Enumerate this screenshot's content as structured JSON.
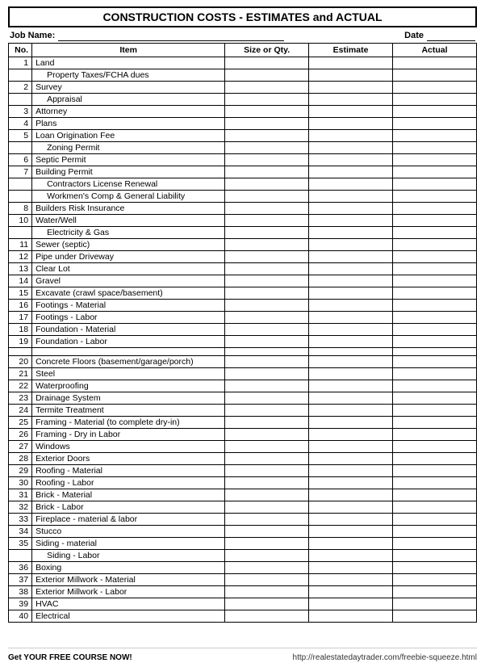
{
  "header": {
    "title": "CONSTRUCTION COSTS - ESTIMATES and ACTUAL",
    "job_name_label": "Job Name:",
    "date_label": "Date"
  },
  "columns": {
    "no": "No.",
    "item": "Item",
    "size_qty": "Size or Qty.",
    "estimate": "Estimate",
    "actual": "Actual"
  },
  "rows": [
    {
      "no": "1",
      "item": "Land",
      "indent": false
    },
    {
      "no": "",
      "item": "Property Taxes/FCHA dues",
      "indent": true
    },
    {
      "no": "2",
      "item": "Survey",
      "indent": false
    },
    {
      "no": "",
      "item": "Appraisal",
      "indent": true
    },
    {
      "no": "3",
      "item": "Attorney",
      "indent": false
    },
    {
      "no": "4",
      "item": "Plans",
      "indent": false
    },
    {
      "no": "5",
      "item": "Loan Origination Fee",
      "indent": false
    },
    {
      "no": "",
      "item": "Zoning Permit",
      "indent": true
    },
    {
      "no": "6",
      "item": "Septic Permit",
      "indent": false
    },
    {
      "no": "7",
      "item": "Building Permit",
      "indent": false
    },
    {
      "no": "",
      "item": "Contractors License Renewal",
      "indent": true
    },
    {
      "no": "",
      "item": "Workmen's Comp & General Liability",
      "indent": true
    },
    {
      "no": "8",
      "item": "Builders Risk Insurance",
      "indent": false
    },
    {
      "no": "10",
      "item": "Water/Well",
      "indent": false
    },
    {
      "no": "",
      "item": "Electricity & Gas",
      "indent": true
    },
    {
      "no": "11",
      "item": "Sewer (septic)",
      "indent": false
    },
    {
      "no": "12",
      "item": "Pipe under Driveway",
      "indent": false
    },
    {
      "no": "13",
      "item": "Clear Lot",
      "indent": false
    },
    {
      "no": "14",
      "item": "Gravel",
      "indent": false
    },
    {
      "no": "15",
      "item": "Excavate (crawl space/basement)",
      "indent": false
    },
    {
      "no": "16",
      "item": "Footings - Material",
      "indent": false
    },
    {
      "no": "17",
      "item": "Footings - Labor",
      "indent": false
    },
    {
      "no": "18",
      "item": "Foundation - Material",
      "indent": false
    },
    {
      "no": "19",
      "item": "Foundation - Labor",
      "indent": false
    },
    {
      "no": "",
      "item": "",
      "indent": false,
      "empty": true
    },
    {
      "no": "20",
      "item": "Concrete Floors (basement/garage/porch)",
      "indent": false
    },
    {
      "no": "21",
      "item": "Steel",
      "indent": false
    },
    {
      "no": "22",
      "item": "Waterproofing",
      "indent": false
    },
    {
      "no": "23",
      "item": "Drainage System",
      "indent": false
    },
    {
      "no": "24",
      "item": "Termite Treatment",
      "indent": false
    },
    {
      "no": "25",
      "item": "Framing - Material (to complete dry-in)",
      "indent": false
    },
    {
      "no": "26",
      "item": "Framing - Dry in Labor",
      "indent": false
    },
    {
      "no": "27",
      "item": "Windows",
      "indent": false
    },
    {
      "no": "28",
      "item": "Exterior Doors",
      "indent": false
    },
    {
      "no": "29",
      "item": "Roofing - Material",
      "indent": false
    },
    {
      "no": "30",
      "item": "Roofing - Labor",
      "indent": false
    },
    {
      "no": "31",
      "item": "Brick - Material",
      "indent": false
    },
    {
      "no": "32",
      "item": "Brick - Labor",
      "indent": false
    },
    {
      "no": "33",
      "item": "Fireplace - material & labor",
      "indent": false
    },
    {
      "no": "34",
      "item": "Stucco",
      "indent": false
    },
    {
      "no": "35",
      "item": "Siding - material",
      "indent": false
    },
    {
      "no": "",
      "item": "Siding - Labor",
      "indent": true
    },
    {
      "no": "36",
      "item": "Boxing",
      "indent": false
    },
    {
      "no": "37",
      "item": "Exterior Millwork - Material",
      "indent": false
    },
    {
      "no": "38",
      "item": "Exterior Millwork - Labor",
      "indent": false
    },
    {
      "no": "39",
      "item": "HVAC",
      "indent": false
    },
    {
      "no": "40",
      "item": "Electrical",
      "indent": false
    }
  ],
  "footer": {
    "left": "Get YOUR FREE COURSE NOW!",
    "right": "http://realestatedaytrader.com/freebie-squeeze.html"
  }
}
